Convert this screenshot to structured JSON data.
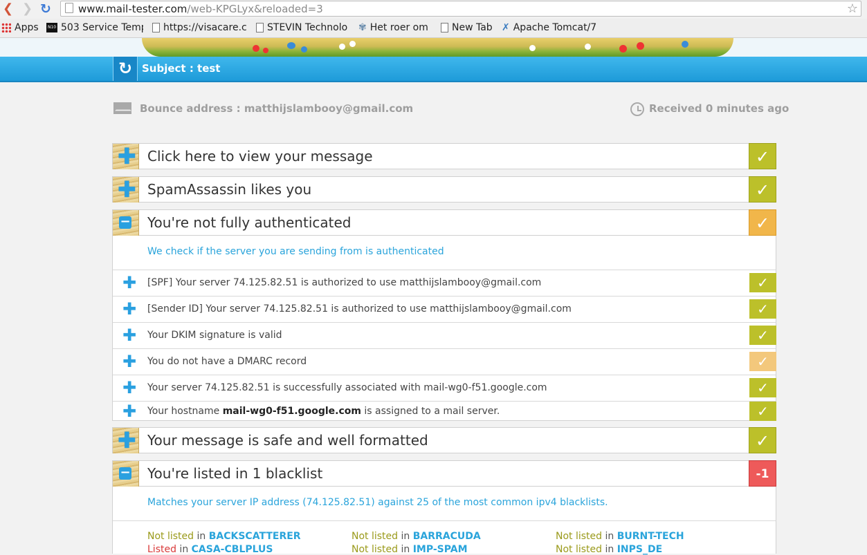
{
  "browser": {
    "url_host": "www.mail-tester.com",
    "url_path": "/web-KPGLyx&reloaded=3",
    "bookmarks": [
      "Apps",
      "503 Service Temp",
      "https://visacare.c",
      "STEVIN Technolo",
      "Het roer om",
      "New Tab",
      "Apache Tomcat/7"
    ],
    "bookmark_icons": [
      "apps-grid-icon",
      "n10-icon",
      "page-icon",
      "page-icon",
      "gear-icon",
      "page-icon",
      "tomcat-icon"
    ]
  },
  "subject": "Subject : test",
  "bounce": "Bounce address : matthijslambooy@gmail.com",
  "received": "Received 0 minutes ago",
  "sections": {
    "view_message": {
      "title": "Click here to view your message",
      "badge": "✓"
    },
    "spamassassin": {
      "title": "SpamAssassin likes you",
      "badge": "✓"
    },
    "auth": {
      "title": "You're not fully authenticated",
      "badge": "✓",
      "intro": "We check if the server you are sending from is authenticated",
      "items": [
        {
          "text": "[SPF] Your server 74.125.82.51 is authorized to use matthijslambooy@gmail.com",
          "status": "ok"
        },
        {
          "text": "[Sender ID] Your server 74.125.82.51 is authorized to use matthijslambooy@gmail.com",
          "status": "ok"
        },
        {
          "text": "Your DKIM signature is valid",
          "status": "ok"
        },
        {
          "text": "You do not have a DMARC record",
          "status": "warn"
        },
        {
          "text": "Your server 74.125.82.51 is successfully associated with mail-wg0-f51.google.com",
          "status": "ok"
        }
      ],
      "hostname": {
        "prefix": "Your hostname ",
        "host": "mail-wg0-f51.google.com",
        "suffix": " is assigned to a mail server.",
        "status": "ok"
      }
    },
    "formatted": {
      "title": "Your message is safe and well formatted",
      "badge": "✓"
    },
    "blacklist": {
      "title": "You're listed in 1 blacklist",
      "badge": "-1",
      "intro": "Matches your server IP address (74.125.82.51) against 25 of the most common ipv4 blacklists.",
      "in_word": " in ",
      "lists": [
        {
          "status": "Not listed",
          "name": "BACKSCATTERER"
        },
        {
          "status": "Not listed",
          "name": "BARRACUDA"
        },
        {
          "status": "Not listed",
          "name": "BURNT-TECH"
        },
        {
          "status": "Listed",
          "name": "CASA-CBLPLUS"
        },
        {
          "status": "Not listed",
          "name": "IMP-SPAM"
        },
        {
          "status": "Not listed",
          "name": "INPS_DE"
        }
      ]
    }
  },
  "colors": {
    "accent": "#2aa4db",
    "ok": "#bcc02a",
    "warn": "#f1b64a",
    "bad": "#ee5a5a"
  }
}
